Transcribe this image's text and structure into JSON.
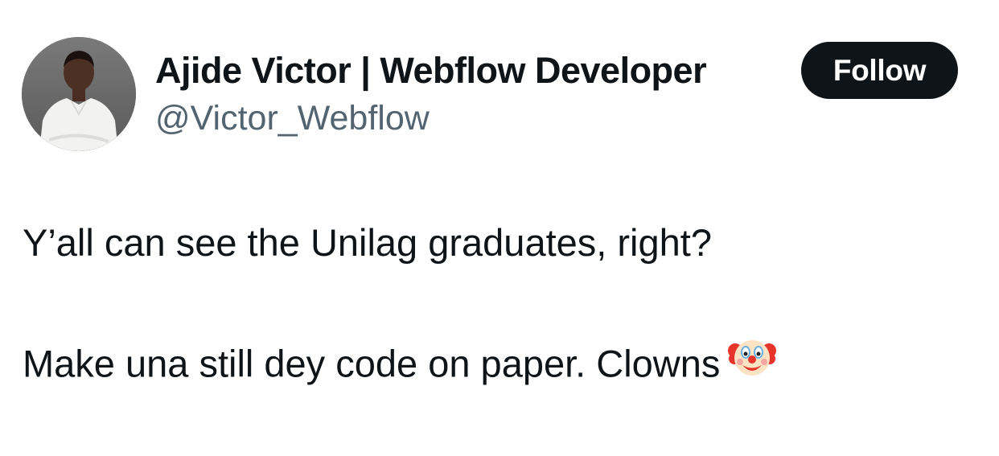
{
  "tweet": {
    "author": {
      "display_name": "Ajide Victor | Webflow Developer",
      "handle": "@Victor_Webflow",
      "avatar_icon": "profile-photo"
    },
    "follow_label": "Follow",
    "text_line_1": "Y’all can see the Unilag graduates, right?",
    "text_line_2": "Make una still dey code on paper. Clowns",
    "emoji_icon": "clown-face-icon"
  },
  "colors": {
    "text_primary": "#0f1419",
    "text_secondary": "#536471",
    "button_bg": "#0f1419",
    "button_text": "#ffffff",
    "background": "#ffffff"
  }
}
